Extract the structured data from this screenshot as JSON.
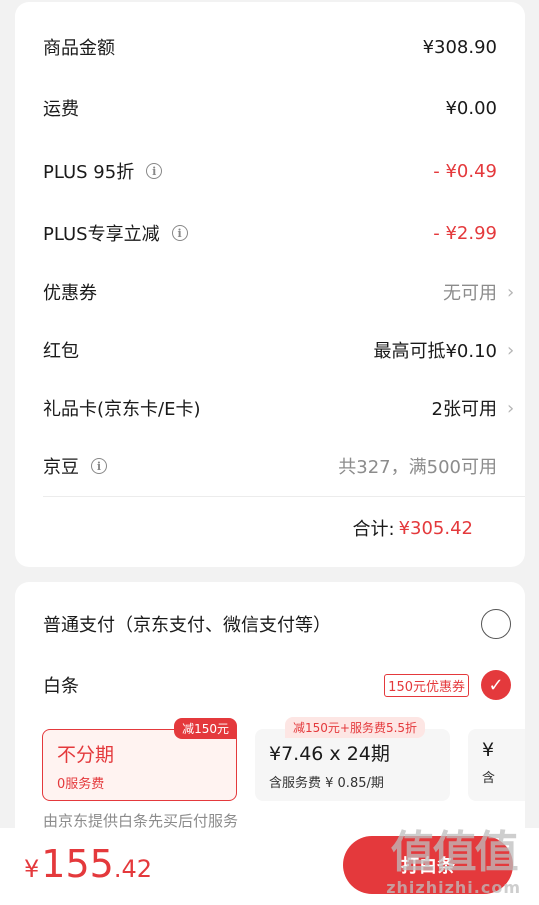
{
  "summary": {
    "rows": [
      {
        "label": "商品金额",
        "value": "¥308.90"
      },
      {
        "label": "运费",
        "value": "¥0.00"
      },
      {
        "label": "PLUS 95折",
        "value": "- ¥0.49"
      },
      {
        "label": "PLUS专享立减",
        "value": "- ¥2.99"
      },
      {
        "label": "优惠券",
        "value": "无可用"
      },
      {
        "label": "红包",
        "value": "最高可抵¥0.10"
      },
      {
        "label": "礼品卡(京东卡/E卡)",
        "value": "2张可用"
      },
      {
        "label": "京豆",
        "value": "共327，满500可用"
      }
    ],
    "total_label": "合计:",
    "total_value": "¥305.42"
  },
  "payment": {
    "normal_label": "普通支付（京东支付、微信支付等）",
    "baitiao_label": "白条",
    "coupon_tag": "150元优惠券",
    "plans": [
      {
        "title": "不分期",
        "sub": "0服务费",
        "badge": "减150元",
        "selected": true
      },
      {
        "title": "¥7.46 x 24期",
        "sub": "含服务费 ¥ 0.85/期",
        "badge": "减150元+服务费5.5折",
        "selected": false
      },
      {
        "title": "¥",
        "sub": "含",
        "badge": "",
        "selected": false
      }
    ],
    "note": "由京东提供白条先买后付服务"
  },
  "bottom": {
    "currency": "¥",
    "price_int": "155",
    "price_dec": ".42",
    "pay_button": "打白条"
  },
  "watermark": {
    "text": "值值值",
    "site": "zhizhizhi.com"
  },
  "colors": {
    "accent": "#e4393c",
    "muted": "#8c8c8c",
    "background": "#f2f2f2"
  },
  "icons": {
    "info": "info-icon",
    "chevron": "chevron-right-icon",
    "check": "check-icon"
  }
}
